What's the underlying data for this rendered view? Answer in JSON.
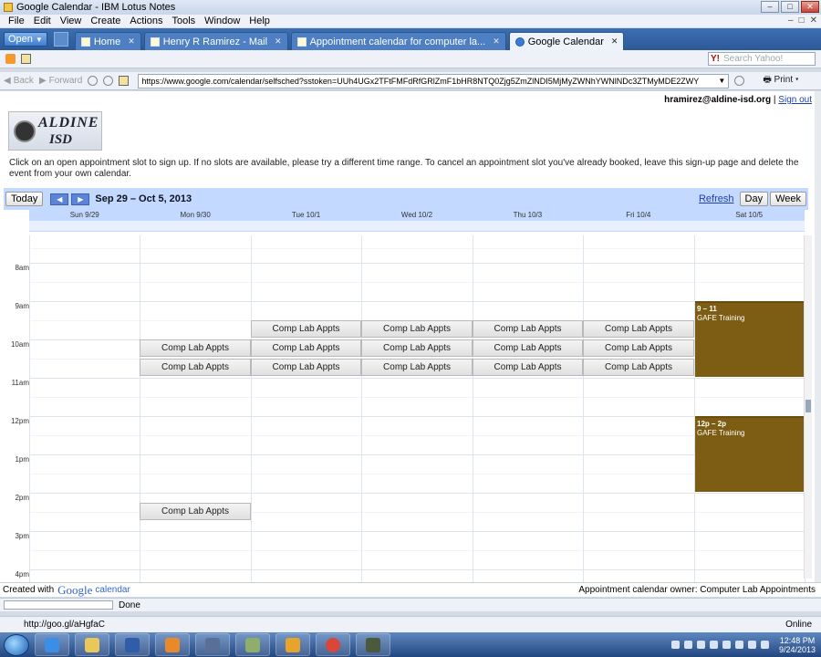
{
  "window": {
    "title": "Google Calendar - IBM Lotus Notes"
  },
  "menu": [
    "File",
    "Edit",
    "View",
    "Create",
    "Actions",
    "Tools",
    "Window",
    "Help"
  ],
  "tabs": {
    "open_label": "Open",
    "items": [
      {
        "label": "Home"
      },
      {
        "label": "Henry R Ramirez - Mail"
      },
      {
        "label": "Appointment calendar for computer la..."
      },
      {
        "label": "Google Calendar"
      }
    ]
  },
  "search": {
    "placeholder": "Search Yahoo!"
  },
  "nav": {
    "back_label": "Back",
    "forward_label": "Forward",
    "url": "https://www.google.com/calendar/selfsched?sstoken=UUh4UGx2TFtFMFdRfGRlZmF1bHR8NTQ0Zjg5ZmZlNDI5MjMyZWNhYWNlNDc3ZTMyMDE2ZWY",
    "print_label": "Print"
  },
  "account": {
    "email": "hramirez@aldine-isd.org",
    "separator": " | ",
    "signout": "Sign out"
  },
  "logo": {
    "line1": "ALDINE",
    "line2": "ISD"
  },
  "instructions": "Click on an open appointment slot to sign up. If no slots are available, please try a different time range. To cancel an appointment slot you've already booked, leave this sign-up page and delete the event from your own calendar.",
  "calendar": {
    "today_label": "Today",
    "prev_label": "◀",
    "next_label": "▶",
    "date_range": "Sep 29 – Oct 5, 2013",
    "refresh_label": "Refresh",
    "day_label": "Day",
    "week_label": "Week",
    "days": [
      "Sun 9/29",
      "Mon 9/30",
      "Tue 10/1",
      "Wed 10/2",
      "Thu 10/3",
      "Fri 10/4",
      "Sat 10/5"
    ],
    "hours": [
      "8am",
      "9am",
      "10am",
      "11am",
      "12pm",
      "1pm",
      "2pm",
      "3pm",
      "4pm"
    ],
    "slot_label": "Comp Lab Appts",
    "events": [
      {
        "time": "9 – 11",
        "title": "GAFE Training"
      },
      {
        "time": "12p – 2p",
        "title": "GAFE Training"
      }
    ]
  },
  "footer": {
    "created_with": "Created with",
    "google": "Google",
    "calendar": "calendar",
    "owner": "Appointment calendar owner: Computer Lab Appointments"
  },
  "status": {
    "done": "Done",
    "link": "http://goo.gl/aHgfaC",
    "online": "Online"
  },
  "clock": {
    "time": "12:48 PM",
    "date": "9/24/2013"
  }
}
